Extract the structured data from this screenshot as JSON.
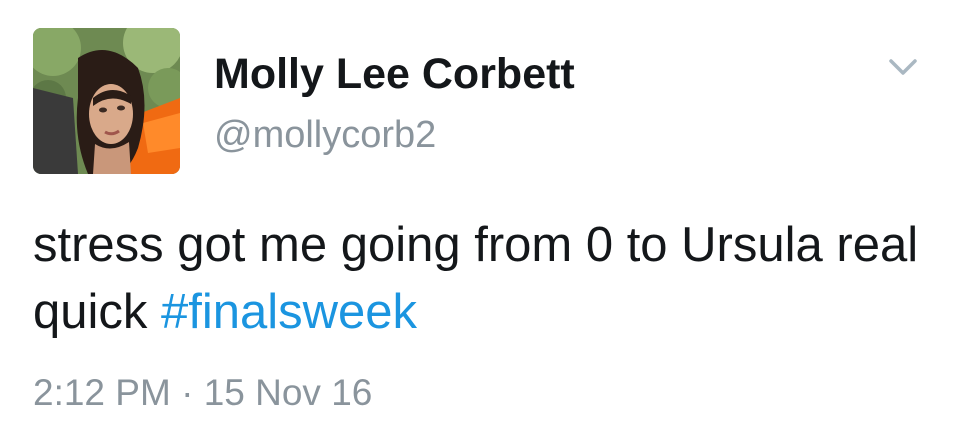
{
  "user": {
    "display_name": "Molly Lee Corbett",
    "handle": "@mollycorb2",
    "avatar_icon": "profile-photo"
  },
  "tweet": {
    "text_before": "stress got me going from 0 to Ursula real quick ",
    "hashtag": "#finalsweek",
    "time": "2:12 PM",
    "separator": " · ",
    "date": "15 Nov 16"
  },
  "menu": {
    "icon": "chevron-down-icon"
  },
  "colors": {
    "text": "#14171a",
    "secondary": "#8a949c",
    "link": "#1b95e0"
  }
}
